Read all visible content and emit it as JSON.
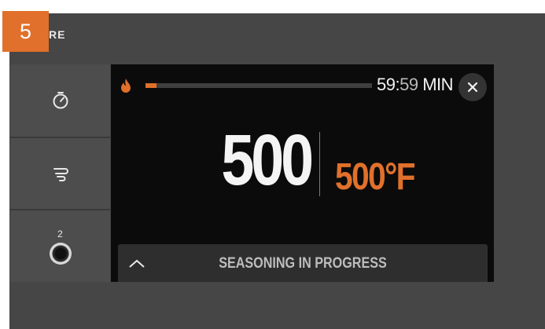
{
  "step_badge": "5",
  "top_label": "RE",
  "sidebar": {
    "timer_button": {
      "icon": "stopwatch-icon"
    },
    "smoke_button": {
      "icon": "smoke-icon"
    },
    "probe_button": {
      "icon": "probe-jack-icon",
      "count": "2"
    }
  },
  "screen": {
    "flame_icon": "flame-icon",
    "progress": 0.05,
    "timer_minutes": "59:",
    "timer_seconds": "59",
    "timer_unit": " MIN",
    "close_icon": "close-icon",
    "actual_temp": "500",
    "set_temp": "500°F",
    "status": "SEASONING IN PROGRESS",
    "expand_icon": "chevron-up-icon"
  },
  "colors": {
    "accent": "#e0702b",
    "device_bg": "#464646",
    "screen_bg": "#0b0b0b",
    "button_bg": "#4d4d4d"
  }
}
